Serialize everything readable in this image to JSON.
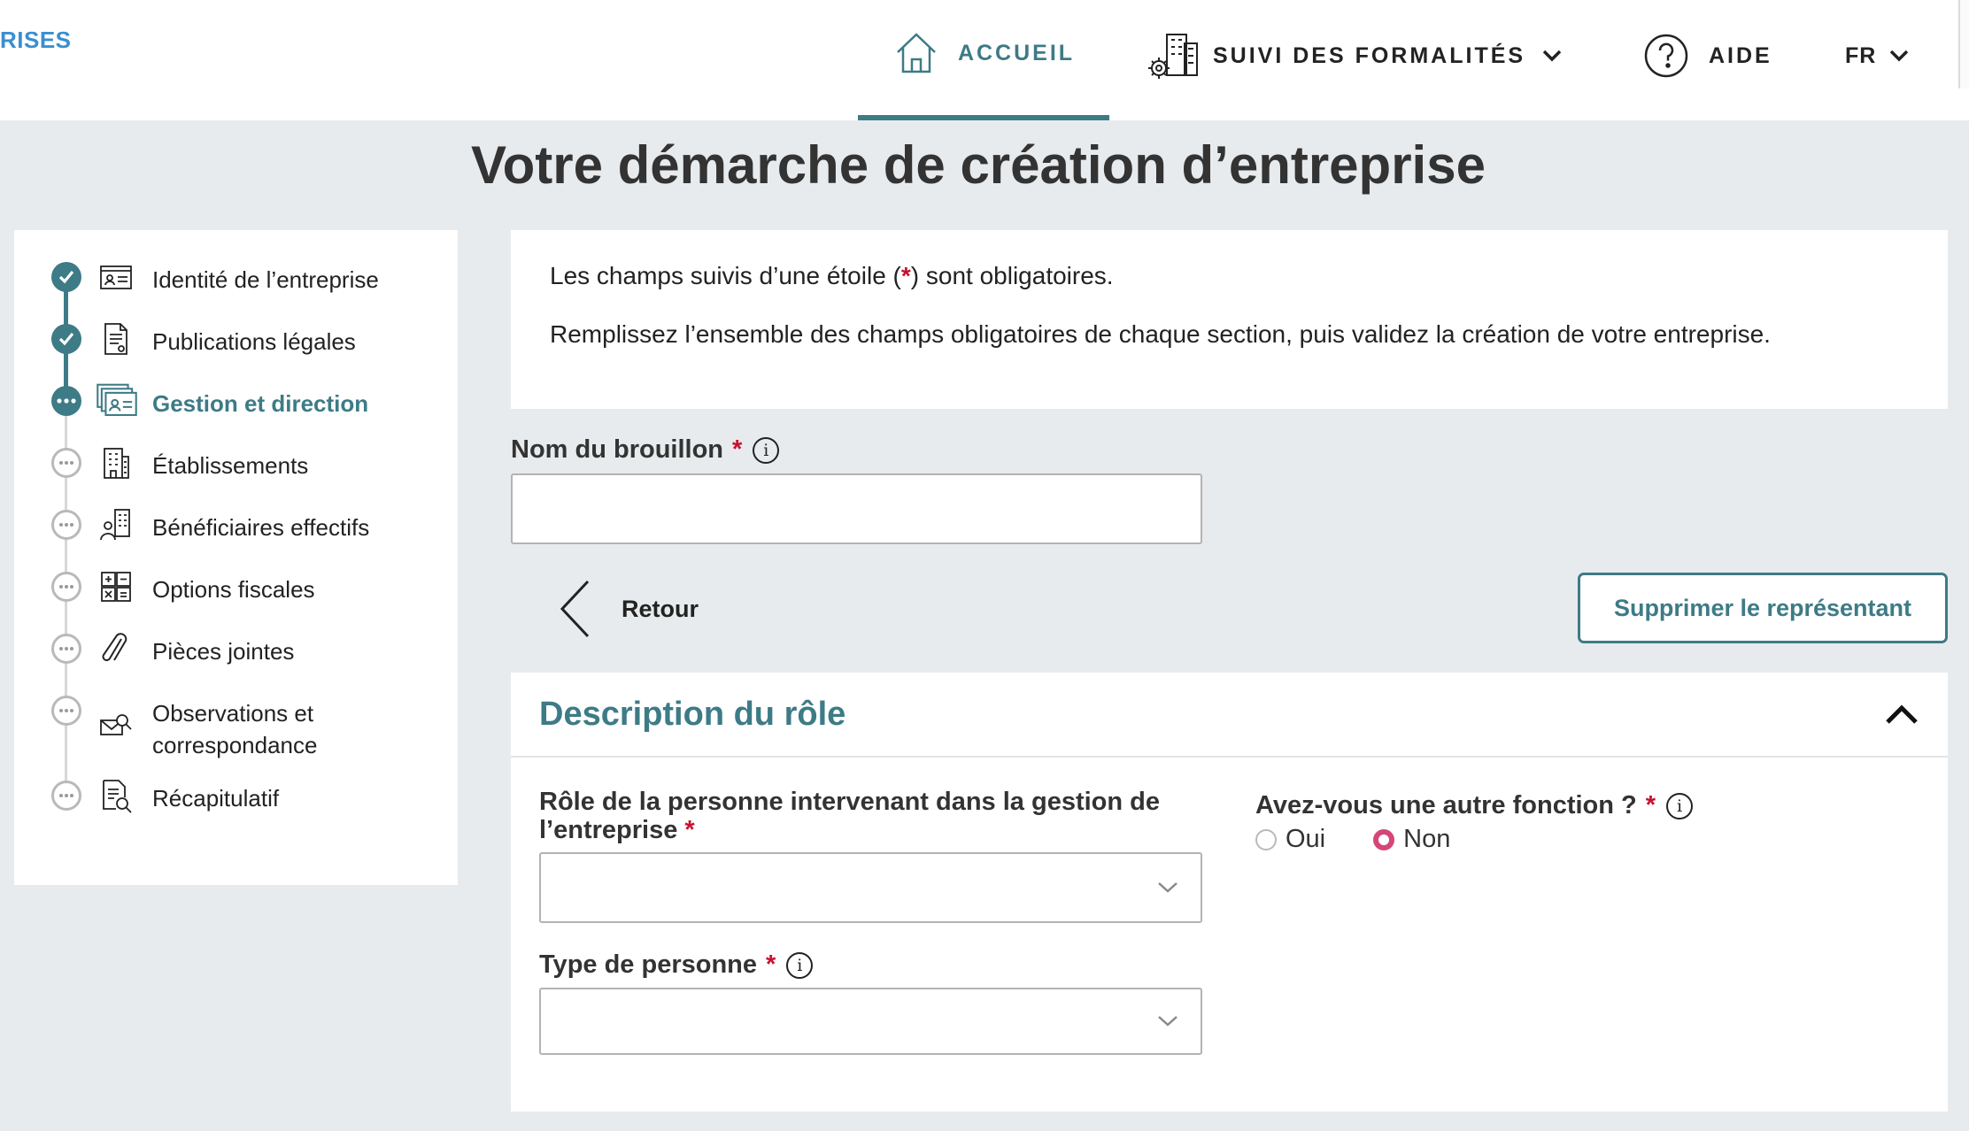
{
  "header": {
    "brand": "RISES",
    "nav": {
      "home": "ACCUEIL",
      "tracking": "SUIVI DES FORMALITÉS",
      "help": "AIDE",
      "language": "FR"
    }
  },
  "page": {
    "title": "Votre démarche de création d’entreprise"
  },
  "sidebar": {
    "steps": [
      {
        "label": "Identité de l’entreprise",
        "status": "done",
        "icon": "id-card-icon"
      },
      {
        "label": "Publications légales",
        "status": "done",
        "icon": "document-icon"
      },
      {
        "label": "Gestion et direction",
        "status": "current",
        "icon": "management-cards-icon"
      },
      {
        "label": "Établissements",
        "status": "todo",
        "icon": "building-icon"
      },
      {
        "label": "Bénéficiaires effectifs",
        "status": "todo",
        "icon": "beneficiaries-icon"
      },
      {
        "label": "Options fiscales",
        "status": "todo",
        "icon": "calculator-icon"
      },
      {
        "label": "Pièces jointes",
        "status": "todo",
        "icon": "paperclip-icon"
      },
      {
        "label": "Observations et correspondance",
        "status": "todo",
        "icon": "mail-search-icon"
      },
      {
        "label": "Récapitulatif",
        "status": "todo",
        "icon": "summary-icon"
      }
    ]
  },
  "info": {
    "line1_before": "Les champs suivis d’une étoile (",
    "line1_star": "*",
    "line1_after": ") sont obligatoires.",
    "line2": "Remplissez l’ensemble des champs obligatoires de chaque section, puis validez la création de votre entreprise."
  },
  "draft": {
    "label": "Nom du brouillon",
    "required": "*",
    "value": ""
  },
  "actions": {
    "back": "Retour",
    "delete_representative": "Supprimer le représentant"
  },
  "role_section": {
    "title": "Description du rôle",
    "role_label": "Rôle de la personne intervenant dans la gestion de l’entreprise",
    "role_required": "*",
    "role_value": "",
    "person_type_label": "Type de personne",
    "person_type_required": "*",
    "person_type_value": "",
    "other_function_label": "Avez-vous une autre fonction ?",
    "other_function_required": "*",
    "other_function_options": [
      "Oui",
      "Non"
    ],
    "other_function_selected": "Non"
  },
  "colors": {
    "accent": "#3d7b86",
    "brand": "#3a8fd0",
    "required": "#c8102e",
    "radio_selected": "#d6457a",
    "background": "#e8ebed"
  }
}
